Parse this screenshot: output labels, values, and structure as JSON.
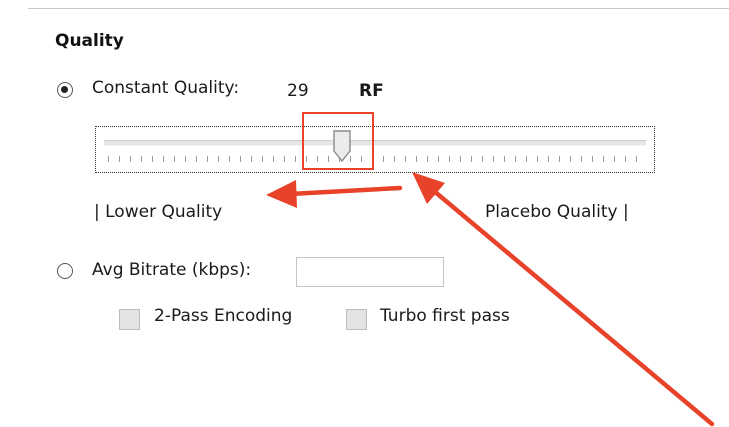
{
  "quality": {
    "title": "Quality",
    "constant_quality": {
      "label": "Constant Quality:",
      "value": "29",
      "unit": "RF",
      "selected": true
    },
    "slider": {
      "min_label": "| Lower Quality",
      "max_label": "Placebo Quality |",
      "position_fraction": 0.44
    },
    "avg_bitrate": {
      "label": "Avg Bitrate (kbps):",
      "value": "",
      "selected": false
    },
    "two_pass": {
      "label": "2-Pass Encoding",
      "checked": false
    },
    "turbo_first_pass": {
      "label": "Turbo first pass",
      "checked": false
    }
  },
  "annotation": {
    "color": "#e8432a"
  },
  "icons": {
    "constant_quality_radio": "radio-selected-icon",
    "avg_bitrate_radio": "radio-unselected-icon",
    "slider_thumb": "slider-thumb-icon"
  }
}
